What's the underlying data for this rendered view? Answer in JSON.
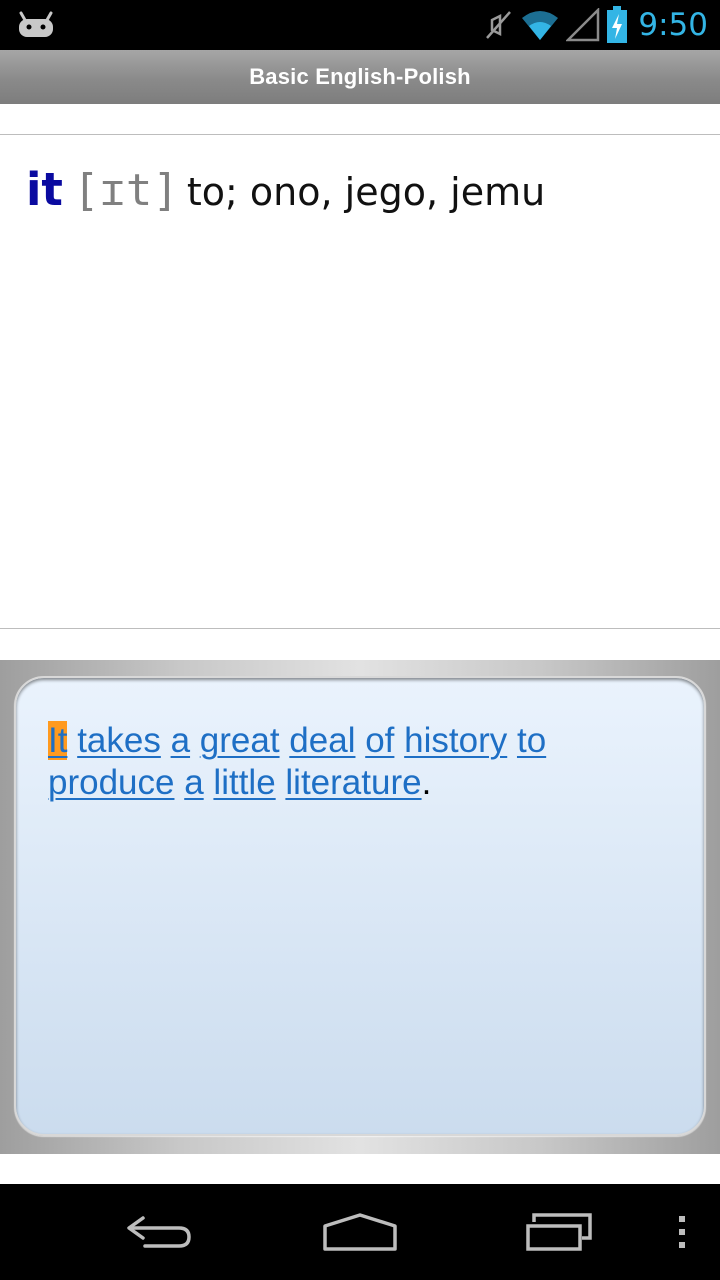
{
  "status_bar": {
    "time": "9:50",
    "icons": [
      "android-debug-icon",
      "mute-icon",
      "wifi-icon",
      "signal-icon",
      "battery-charging-icon"
    ],
    "clock_color": "#33b5e5"
  },
  "title_bar": {
    "title": "Basic English-Polish"
  },
  "entry": {
    "headword": "it",
    "pronunciation": "[ɪt]",
    "translation": "to; ono, jego, jemu",
    "headword_color": "#0a0aa0"
  },
  "example": {
    "words": [
      {
        "text": "It",
        "highlighted": true
      },
      {
        "text": "takes"
      },
      {
        "text": "a"
      },
      {
        "text": "great"
      },
      {
        "text": "deal"
      },
      {
        "text": "of"
      },
      {
        "text": "history"
      },
      {
        "text": "to"
      },
      {
        "text": "produce"
      },
      {
        "text": "a"
      },
      {
        "text": "little"
      },
      {
        "text": "literature"
      }
    ],
    "terminal_punctuation": ".",
    "link_color": "#1e6fc5",
    "highlight_color": "#ff9a1f"
  },
  "nav_bar": {
    "buttons": [
      "back-icon",
      "home-icon",
      "recent-apps-icon",
      "overflow-menu-icon"
    ]
  }
}
